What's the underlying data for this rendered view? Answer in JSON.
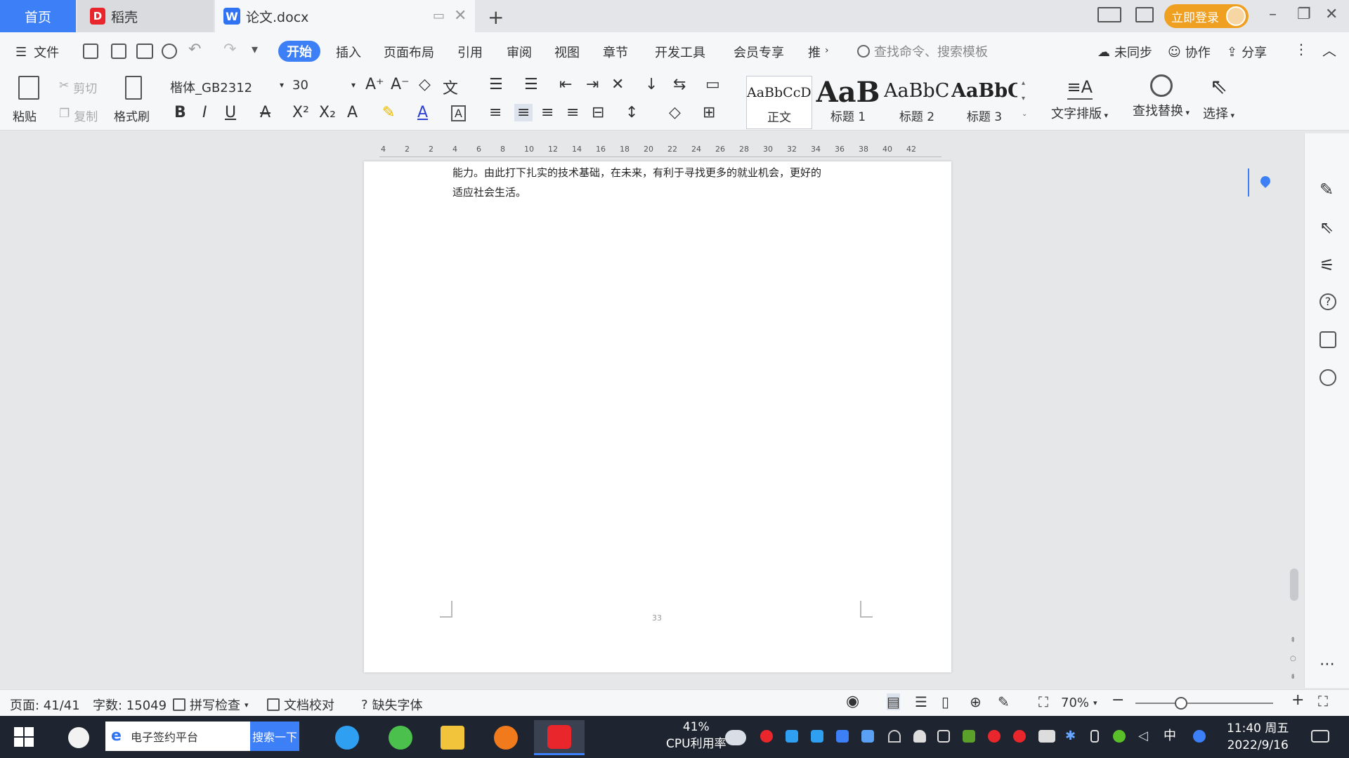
{
  "tabs": {
    "home": "首页",
    "daoke": "稻壳",
    "doc": "论文.docx",
    "login": "立即登录"
  },
  "menu": {
    "file": "文件",
    "items": [
      "开始",
      "插入",
      "页面布局",
      "引用",
      "审阅",
      "视图",
      "章节",
      "开发工具",
      "会员专享",
      "推"
    ],
    "search_placeholder": "查找命令、搜索模板",
    "sync": "未同步",
    "collab": "协作",
    "share": "分享"
  },
  "ribbon": {
    "paste": "粘贴",
    "cut": "剪切",
    "copy": "复制",
    "format_painter": "格式刷",
    "font_name": "楷体_GB2312",
    "font_size": "30",
    "styles": [
      {
        "preview": "AaBbCcDd",
        "name": "正文"
      },
      {
        "preview": "AaB",
        "name": "标题 1"
      },
      {
        "preview": "AaBbCc",
        "name": "标题 2"
      },
      {
        "preview": "AaBbC",
        "name": "标题 3"
      }
    ],
    "text_layout": "文字排版",
    "find_replace": "查找替换",
    "select": "选择"
  },
  "ruler_ticks": [
    "4",
    "2",
    "2",
    "4",
    "6",
    "8",
    "10",
    "12",
    "14",
    "16",
    "18",
    "20",
    "22",
    "24",
    "26",
    "28",
    "30",
    "32",
    "34",
    "36",
    "38",
    "40",
    "42"
  ],
  "document": {
    "line1": "能力。由此打下扎实的技术基础，在未来，有利于寻找更多的就业机会，更好的",
    "line2": "适应社会生活。",
    "page_footer_num": "33"
  },
  "status": {
    "page": "页面: 41/41",
    "words": "字数: 15049",
    "spell": "拼写检查",
    "proof": "文档校对",
    "missing_font": "缺失字体",
    "zoom": "70%"
  },
  "taskbar": {
    "search_text": "电子签约平台",
    "search_btn": "搜索一下",
    "cpu_pct": "41%",
    "cpu_label": "CPU利用率",
    "ime": "中",
    "time": "11:40 周五",
    "date": "2022/9/16"
  }
}
